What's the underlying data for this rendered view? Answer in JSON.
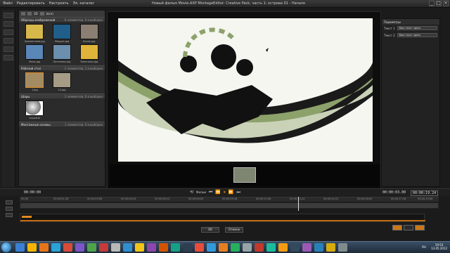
{
  "window": {
    "menu": [
      "Файл",
      "Редактировать",
      "Настроить",
      "Эл. каталог"
    ],
    "title": "Новый фильм Movie.AXP  MontageEditor: Creative Pack, часть 1: острова  01 - Начало",
    "buttons": [
      "_",
      "□",
      "×"
    ]
  },
  "library": {
    "toolbar_label": "(все)",
    "view_label": "3D",
    "sections": [
      {
        "title": "Образцы изображений",
        "count": "6 элементов, 0 в выборке"
      },
      {
        "title": "Рабочий стол",
        "count": "2 элементов, 1 в выборке"
      },
      {
        "title": "Шары",
        "count": "1 элементов, 0 в выборке"
      },
      {
        "title": "Монтажные основы",
        "count": "1 элементов, 0 в выборке"
      }
    ],
    "images": [
      {
        "label": "Хризантема.jpg",
        "color": "#d7b84a"
      },
      {
        "label": "Медуза.jpg",
        "color": "#1f5f8a"
      },
      {
        "label": "Коала.jpg",
        "color": "#8b7f73"
      },
      {
        "label": "Маяк.jpg",
        "color": "#5b86b8"
      },
      {
        "label": "Пингвины.jpg",
        "color": "#6c8fae"
      },
      {
        "label": "Тюльпаны.jpg",
        "color": "#e0b43a"
      }
    ],
    "desktop": [
      {
        "label": "1.jpg",
        "color": "#a38b62"
      },
      {
        "label": "12.jpg",
        "color": "#a69c86"
      }
    ],
    "sphere": {
      "label": "серый.bl",
      "color": "#b6b6b6"
    }
  },
  "preview": {
    "accent_dark": "#111111",
    "accent_green": "#8da16b"
  },
  "settings": {
    "header": "Параметры",
    "rows": [
      {
        "label": "Текст 1",
        "value": "Ваш текст здесь"
      },
      {
        "label": "Текст 2",
        "value": "Ваш текст здесь"
      }
    ]
  },
  "transport": {
    "left_timecode": "00:00:00",
    "mode": "Фильм",
    "timecode_start": "00:00:03.00",
    "timecode_end": "00:00:19.24",
    "buttons": [
      "⏮",
      "⏪",
      "⏸",
      "⏩",
      "⏭"
    ]
  },
  "ruler": [
    "00;00",
    "00;00;01;18",
    "00;00;03;06",
    "00;00;04;24",
    "00;00;06;12",
    "00;00;08;00",
    "00;00;09;18",
    "00;00;11;06",
    "00;00;12;24",
    "00;00;14;12",
    "00;00;16;00",
    "00;00;17;18",
    "00;00;19;06"
  ],
  "dialog": {
    "ok": "OK",
    "cancel": "Отмена"
  },
  "taskbar": {
    "icons": [
      "#3b7fd4",
      "#f4b400",
      "#e8741a",
      "#2aa3d8",
      "#d84b3a",
      "#7a56c8",
      "#4ea34b",
      "#c53a3a",
      "#b8b8b8",
      "#2f8fcf",
      "#f0c419",
      "#8e44ad",
      "#d35400",
      "#16a085",
      "#2c3e50",
      "#e74c3c",
      "#3498db",
      "#e67e22",
      "#27ae60",
      "#95a5a6",
      "#c0392b",
      "#1abc9c",
      "#f39c12",
      "#34495e",
      "#9b59b6",
      "#2980b9",
      "#d4ac0d",
      "#7f8c8d",
      "#e84393",
      "#00a8ff"
    ],
    "lang": "RU",
    "time": "19:53",
    "date": "13.05.2012"
  }
}
